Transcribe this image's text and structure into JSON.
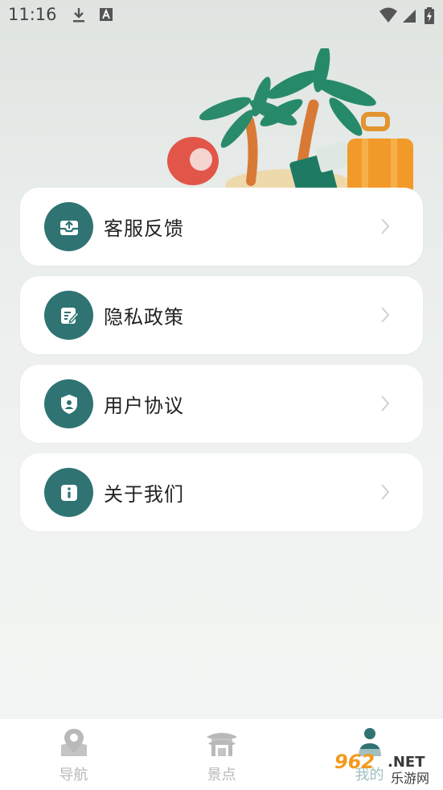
{
  "status_bar": {
    "time": "11:16",
    "icons": [
      "download-icon",
      "a-icon",
      "wifi-icon",
      "signal-icon",
      "battery-icon"
    ]
  },
  "menu": {
    "items": [
      {
        "label": "客服反馈",
        "icon": "inbox-upload-icon"
      },
      {
        "label": "隐私政策",
        "icon": "document-edit-icon"
      },
      {
        "label": "用户协议",
        "icon": "shield-user-icon"
      },
      {
        "label": "关于我们",
        "icon": "info-icon"
      }
    ]
  },
  "bottom_nav": {
    "items": [
      {
        "label": "导航",
        "icon": "map-pin-icon",
        "active": false
      },
      {
        "label": "景点",
        "icon": "pavilion-icon",
        "active": false
      },
      {
        "label": "我的",
        "icon": "user-icon",
        "active": true
      }
    ]
  },
  "watermark": {
    "text_top": "962",
    "text_top_suffix": ".NET",
    "text_bottom": "乐游网"
  },
  "colors": {
    "accent": "#2f7373",
    "inactive": "#b9b9b9",
    "card": "#ffffff",
    "background": "#f2f4f3"
  }
}
